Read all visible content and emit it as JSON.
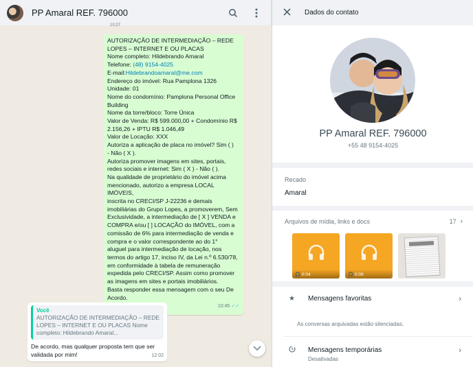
{
  "chat": {
    "contact_name": "PP Amaral REF. 796000",
    "top_timestamp": "10:27",
    "outgoing_message": {
      "lines": [
        "AUTORIZAÇÃO DE INTERMEDIAÇÃO – REDE",
        "LOPES – INTERNET E OU PLACAS",
        "Nome completo: Hildebrando Amaral",
        "Telefone: ",
        "E-mail:",
        "Endereço do imóvel: Rua Pamplona 1326",
        "Unidade: 01",
        "Nome do condomínio: Pamplona Personal Office",
        "Building",
        "Nome da torre/bloco: Torre Única",
        "Valor de Venda: R$ 599.000,00 + Condomínio R$",
        "2.156,26  + IPTU R$ 1.046,49",
        "Valor de Locação: XXX",
        "Autoriza a aplicação de placa no imóvel? Sim (   )",
        "- Não ( X ).",
        "Autoriza promover imagens em sites, portais,",
        "redes sociais e internet: Sim ( X ) - Não (  ).",
        "Na qualidade de proprietário do imóvel acima",
        "mencionado, autorizo a empresa LOCAL IMÓVEIS,",
        "inscrita no CRECI/SP J-22236 e demais",
        "imobiliárias do Grupo Lopes, a promoverem, Sem",
        "Exclusividade, a intermediação de [ X ] VENDA e",
        "COMPRA e/ou [  ] LOCAÇÃO do IMÓVEL, com a",
        "comissão de 6% para intermediação de venda e",
        "compra e o valor correspondente ao do 1°",
        "aluguel para intermediação de locação, nos",
        "termos do artigo 17, inciso IV, da Lei n.º 6.530/78,",
        "em conformidade à tabela de remuneração",
        "expedida pelo CRECI/SP. Assim como promover",
        "as imagens em sites e portais imobiliários.",
        "Basta responder essa mensagem com o seu De",
        "Acordo."
      ],
      "phone_link": "(48) 9154-4025",
      "email_link": "Hildebrandoamaral@me.com",
      "time": "10:45"
    },
    "incoming_message": {
      "quote_author": "Você",
      "quote_text": "AUTORIZAÇÃO DE INTERMEDIAÇÃO – REDE LOPES – INTERNET E OU PLACAS Nome completo: Hildebrando Amaral...",
      "text": "De acordo, mas qualquer proposta tem que ser validada por mim!",
      "time": "12:02"
    }
  },
  "panel": {
    "title": "Dados do contato",
    "name": "PP Amaral REF. 796000",
    "phone": "+55 48 9154-4025",
    "about_label": "Recado",
    "about_value": "Amaral",
    "media_label": "Arquivos de mídia, links e docs",
    "media_count": "17",
    "media": [
      {
        "type": "audio",
        "duration": "0:04"
      },
      {
        "type": "audio",
        "duration": "0:09"
      },
      {
        "type": "document"
      }
    ],
    "favorites_label": "Mensagens favoritas",
    "archived_note": "As conversas arquivadas estão silenciadas.",
    "temporary_label": "Mensagens temporárias",
    "temporary_value": "Desativadas"
  },
  "colors": {
    "outgoing_bubble": "#d9fdd3",
    "accent": "#06cf9c",
    "audio_thumb": "#f5a623",
    "link": "#027eb5"
  }
}
